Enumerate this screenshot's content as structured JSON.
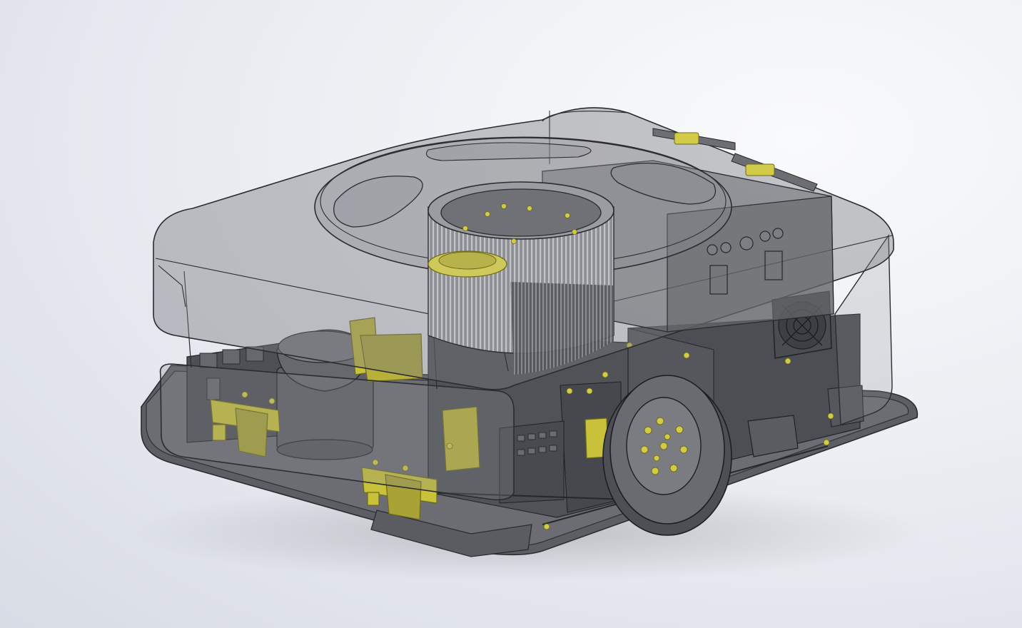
{
  "viewport": {
    "background_top": "#f9fafc",
    "background_bottom": "#d8dce5"
  },
  "model": {
    "shell_color": "#6f7176",
    "shell_edge_color": "#2b2c2f",
    "internal_color": "#505257",
    "hardware_color": "#c9c13a",
    "components": [
      "transparent-top-cover",
      "rotating-turntable",
      "center-ring-gear",
      "drive-wheel",
      "lidar-dome",
      "cooling-fan",
      "hinge",
      "yellow-bracket",
      "base-chassis"
    ]
  }
}
